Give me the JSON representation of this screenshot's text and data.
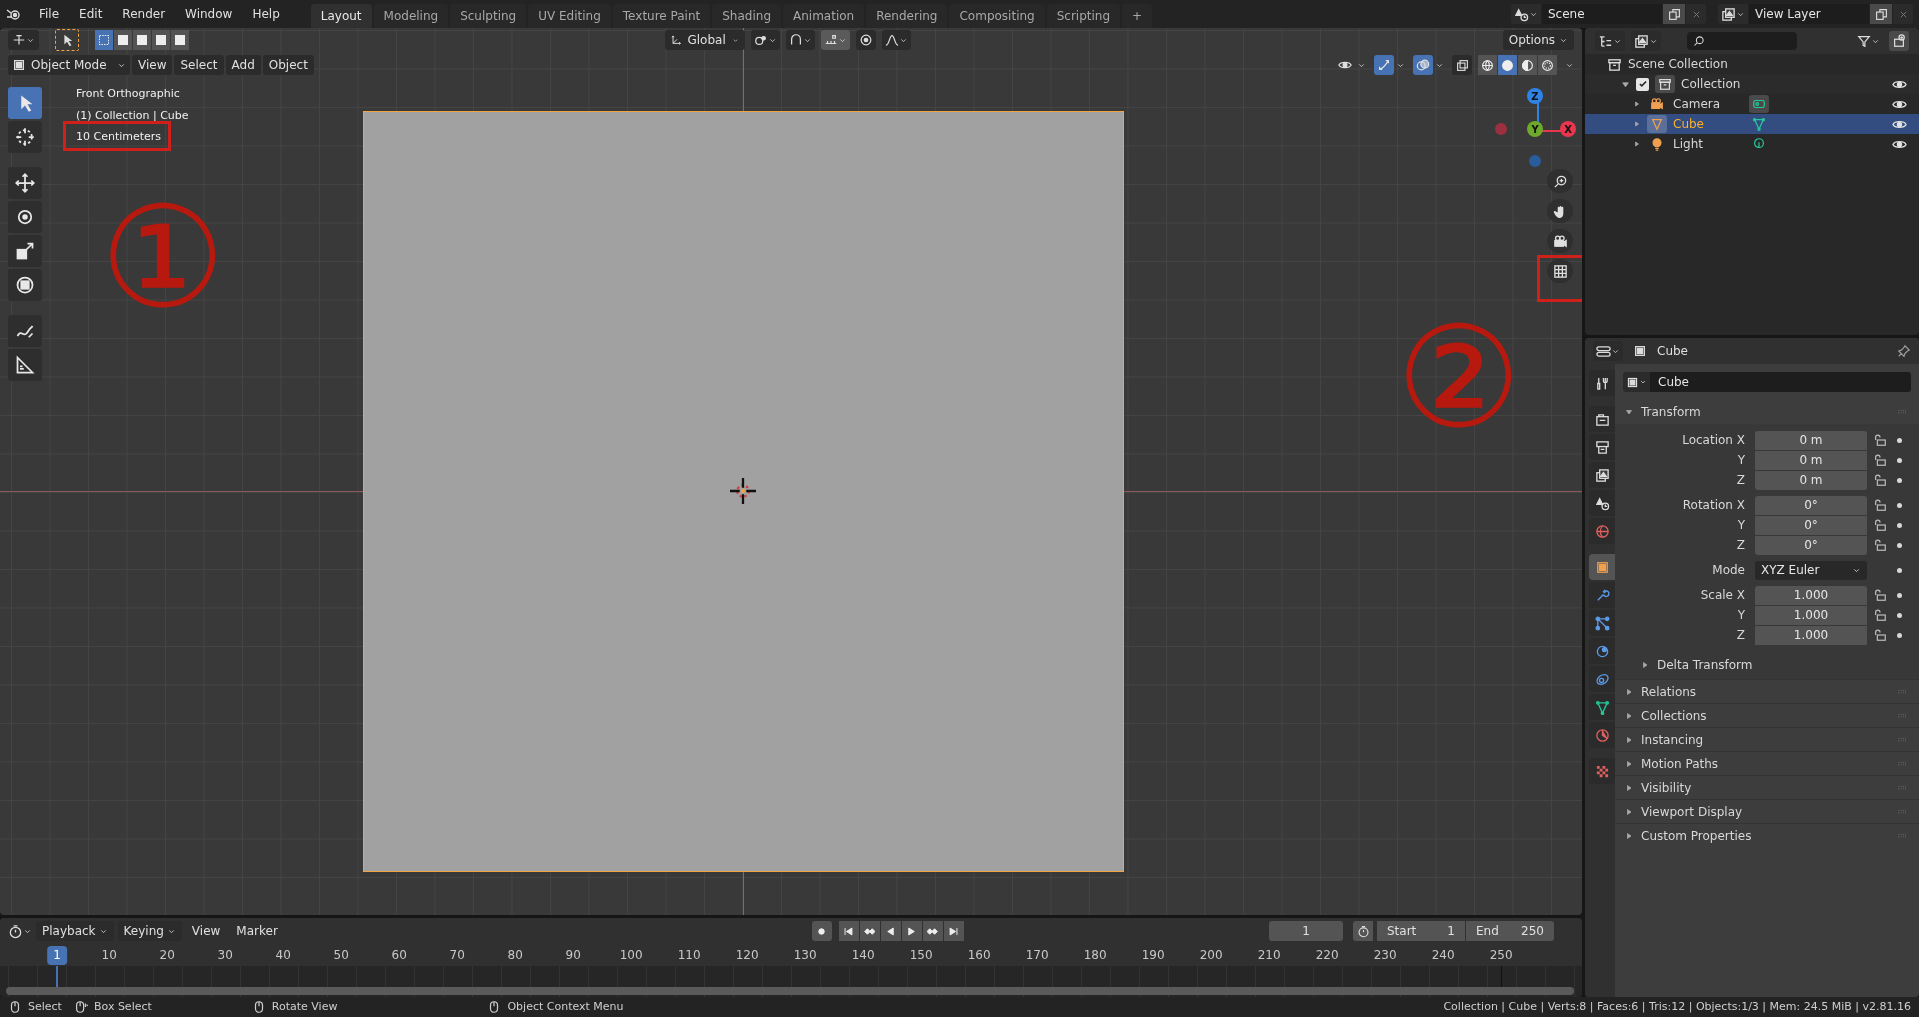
{
  "menu": [
    "File",
    "Edit",
    "Render",
    "Window",
    "Help"
  ],
  "workspace_tabs": [
    {
      "label": "Layout",
      "selected": true
    },
    {
      "label": "Modeling",
      "selected": false
    },
    {
      "label": "Sculpting",
      "selected": false
    },
    {
      "label": "UV Editing",
      "selected": false
    },
    {
      "label": "Texture Paint",
      "selected": false
    },
    {
      "label": "Shading",
      "selected": false
    },
    {
      "label": "Animation",
      "selected": false
    },
    {
      "label": "Rendering",
      "selected": false
    },
    {
      "label": "Compositing",
      "selected": false
    },
    {
      "label": "Scripting",
      "selected": false
    },
    {
      "label": "+",
      "selected": false
    }
  ],
  "scene": {
    "name": "Scene"
  },
  "view_layer": {
    "name": "View Layer"
  },
  "tool_settings": {
    "orientation": "Global",
    "options": "Options"
  },
  "viewport_header": {
    "mode": "Object Mode",
    "menus": [
      "View",
      "Select",
      "Add",
      "Object"
    ]
  },
  "shading_modes": [
    {
      "kind": "wireframe",
      "selected": false
    },
    {
      "kind": "solid",
      "selected": true
    },
    {
      "kind": "material",
      "selected": false
    },
    {
      "kind": "rendered",
      "selected": false
    }
  ],
  "viewport_overlay": {
    "view_name": "Front Orthographic",
    "object_info": "(1) Collection | Cube",
    "grid_scale": "10 Centimeters"
  },
  "gizmo_axes": [
    {
      "label": "Z",
      "kind": "z"
    },
    {
      "label": "Y",
      "kind": "y"
    },
    {
      "label": "X",
      "kind": "x"
    }
  ],
  "annotations": [
    "①",
    "②"
  ],
  "toolbar": [
    {
      "kind": "select",
      "selected": true
    },
    {
      "kind": "cursor",
      "selected": false
    },
    {
      "kind": "move",
      "selected": false
    },
    {
      "kind": "rotate",
      "selected": false
    },
    {
      "kind": "scale",
      "selected": false
    },
    {
      "kind": "transform",
      "selected": false
    },
    {
      "kind": "annotate",
      "selected": false
    },
    {
      "kind": "measure",
      "selected": false
    }
  ],
  "outliner": {
    "root": "Scene Collection",
    "items": [
      {
        "label": "Collection",
        "checked": true,
        "expanded": true,
        "children": [
          {
            "label": "Camera",
            "kind": "camera",
            "selected": false
          },
          {
            "label": "Cube",
            "kind": "mesh",
            "selected": true
          },
          {
            "label": "Light",
            "kind": "light",
            "selected": false
          }
        ]
      }
    ]
  },
  "properties": {
    "header": "Cube",
    "object_name": "Cube",
    "tabs": [
      {
        "kind": "tool",
        "selected": false
      },
      {
        "kind": "render",
        "selected": false
      },
      {
        "kind": "output",
        "selected": false
      },
      {
        "kind": "view-layer",
        "selected": false
      },
      {
        "kind": "scene",
        "selected": false
      },
      {
        "kind": "world",
        "selected": false
      },
      {
        "kind": "object",
        "selected": true
      },
      {
        "kind": "modifier",
        "selected": false
      },
      {
        "kind": "particles",
        "selected": false
      },
      {
        "kind": "physics",
        "selected": false
      },
      {
        "kind": "constraints",
        "selected": false
      },
      {
        "kind": "data",
        "selected": false
      },
      {
        "kind": "material",
        "selected": false
      },
      {
        "kind": "texture",
        "selected": false
      }
    ],
    "transform": {
      "title": "Transform",
      "expanded": true,
      "rows": [
        {
          "label": "Location X",
          "value": "0 m",
          "kind": "number"
        },
        {
          "label": "Y",
          "value": "0 m",
          "kind": "number"
        },
        {
          "label": "Z",
          "value": "0 m",
          "kind": "number"
        },
        {
          "label": "Rotation X",
          "value": "0°",
          "kind": "number"
        },
        {
          "label": "Y",
          "value": "0°",
          "kind": "number"
        },
        {
          "label": "Z",
          "value": "0°",
          "kind": "number"
        },
        {
          "label": "Mode",
          "value": "XYZ Euler",
          "kind": "dropdown"
        },
        {
          "label": "Scale X",
          "value": "1.000",
          "kind": "number"
        },
        {
          "label": "Y",
          "value": "1.000",
          "kind": "number"
        },
        {
          "label": "Z",
          "value": "1.000",
          "kind": "number"
        }
      ],
      "subpanel": "Delta Transform"
    },
    "panels": [
      "Relations",
      "Collections",
      "Instancing",
      "Motion Paths",
      "Visibility",
      "Viewport Display",
      "Custom Properties"
    ]
  },
  "timeline": {
    "menus": [
      "Playback",
      "Keying",
      "View",
      "Marker"
    ],
    "current_frame": "1",
    "start_label": "Start",
    "start": "1",
    "end_label": "End",
    "end": "250",
    "ruler": [
      "1",
      "10",
      "20",
      "30",
      "40",
      "50",
      "60",
      "70",
      "80",
      "90",
      "100",
      "110",
      "120",
      "130",
      "140",
      "150",
      "160",
      "170",
      "180",
      "190",
      "200",
      "210",
      "220",
      "230",
      "240",
      "250"
    ]
  },
  "status_bar": {
    "items": [
      {
        "label": "Select",
        "kind": "left"
      },
      {
        "label": "Box Select",
        "kind": "drag"
      },
      {
        "label": "Rotate View",
        "kind": "middle"
      },
      {
        "label": "Object Context Menu",
        "kind": "right"
      }
    ],
    "stats": "Collection | Cube | Verts:8 | Faces:6 | Tris:12 | Objects:1/3 | Mem: 24.5 MiB | v2.81.16"
  }
}
